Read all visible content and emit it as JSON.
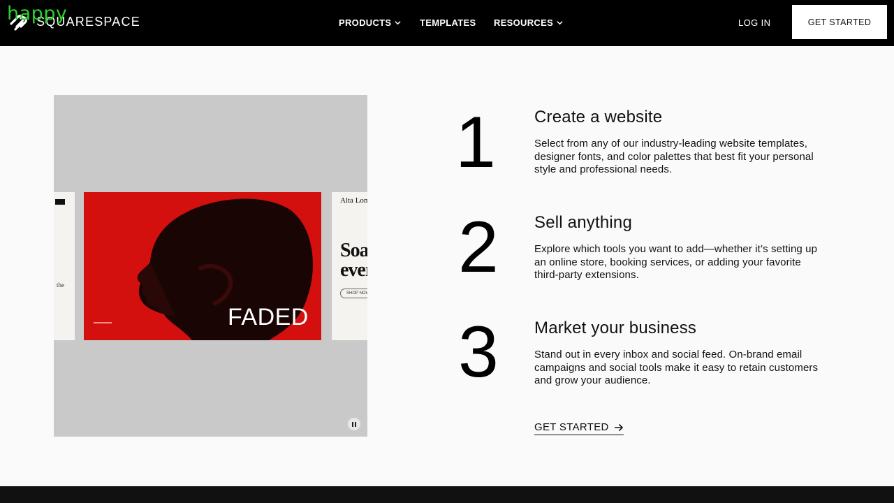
{
  "watermark": "happy",
  "header": {
    "brand": "SQUARESPACE",
    "nav": {
      "products": "PRODUCTS",
      "templates": "TEMPLATES",
      "resources": "RESOURCES",
      "login": "LOG IN"
    },
    "get_started": "GET STARTED"
  },
  "media": {
    "main_slide_text": "FADED",
    "right_slide_title": "Alta Lom",
    "right_slide_headline_1": "Soa",
    "right_slide_headline_2": "ever",
    "right_slide_button": "SHOP NOW",
    "left_slide_text": "the"
  },
  "steps": [
    {
      "number": "1",
      "title": "Create a website",
      "body": "Select from any of our industry-leading website templates, designer fonts, and color palettes that best fit your personal style and professional needs."
    },
    {
      "number": "2",
      "title": "Sell anything",
      "body": "Explore which tools you want to add—whether it’s setting up an online store, booking services, or adding your favorite third-party extensions."
    },
    {
      "number": "3",
      "title": "Market your business",
      "body": "Stand out in every inbox and social feed. On-brand email campaigns and social tools make it easy to retain customers and grow your audience."
    }
  ],
  "cta": {
    "label": "GET STARTED"
  },
  "colors": {
    "header_bg": "#000000",
    "accent_red": "#d4100f",
    "watermark": "#2ad12a"
  }
}
